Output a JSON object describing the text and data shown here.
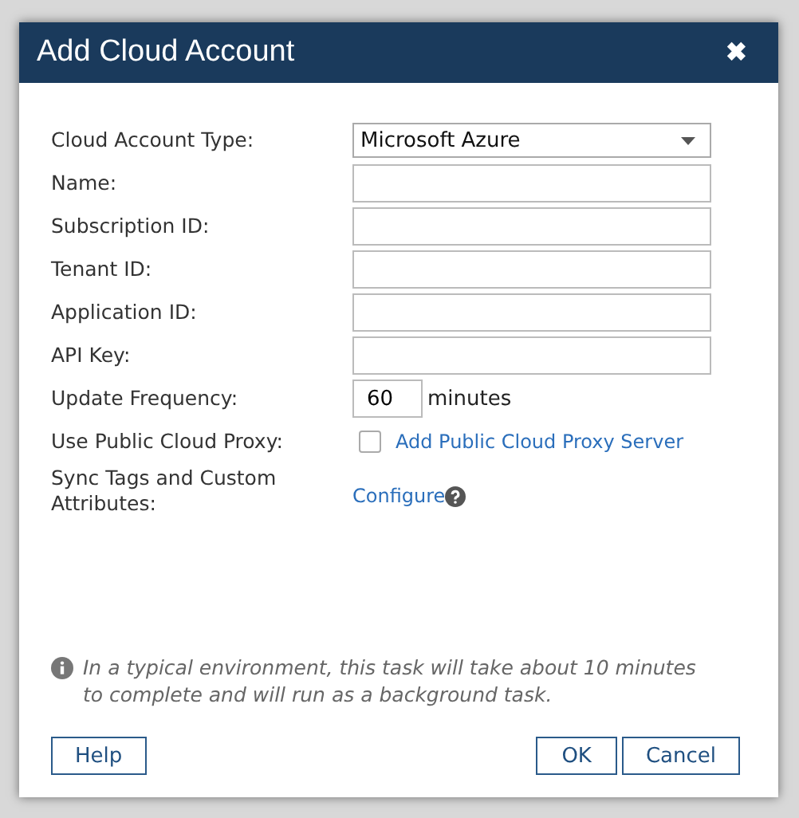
{
  "dialog": {
    "title": "Add Cloud Account",
    "close": "✖"
  },
  "fields": [
    {
      "label": "Cloud Account Type:",
      "kind": "select",
      "value": "Microsoft Azure"
    },
    {
      "label": "Name:",
      "kind": "text"
    },
    {
      "label": "Subscription ID:",
      "kind": "text"
    },
    {
      "label": "Tenant ID:",
      "kind": "text"
    },
    {
      "label": "Application ID:",
      "kind": "text"
    },
    {
      "label": "API Key:",
      "kind": "text"
    },
    {
      "label": "Update Frequency:",
      "kind": "number",
      "value": "60",
      "unit": "minutes"
    },
    {
      "label": "Use Public Cloud Proxy:",
      "kind": "checkbox",
      "checked": false,
      "link": "Add Public Cloud Proxy Server"
    },
    {
      "label": "Sync Tags and Custom Attributes:",
      "kind": "link",
      "link": "Configure"
    }
  ],
  "note": "In a typical environment, this task will take about 10 minutes to complete and will run as a background task.",
  "buttons": {
    "left": [
      "Help"
    ],
    "right": [
      "OK",
      "Cancel"
    ]
  }
}
